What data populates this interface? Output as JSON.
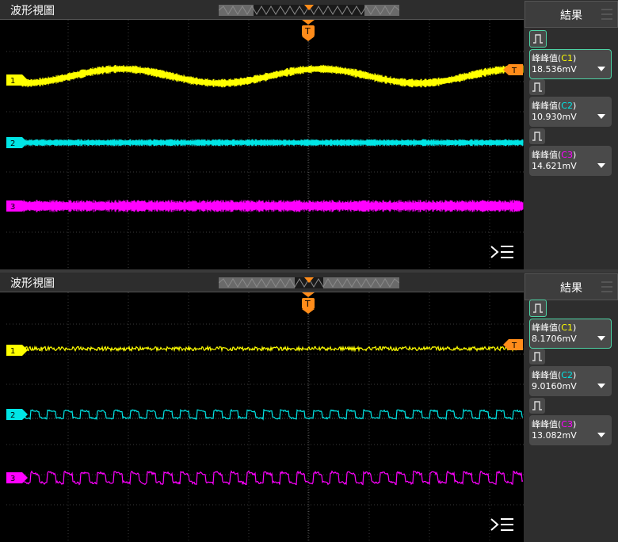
{
  "colors": {
    "ch1": "#ffff00",
    "ch2": "#00e5e5",
    "ch3": "#ff00ff",
    "trigger": "#ff8c1a",
    "accent": "#4dd3a5"
  },
  "panels": [
    {
      "title": "波形視圖",
      "results_title": "結果",
      "channel_markers": [
        "1",
        "2",
        "3"
      ],
      "trigger_label": "T",
      "measurements": [
        {
          "label": "峰峰值",
          "channel": "C1",
          "value": "18.536mV",
          "selected": true,
          "icon": "pulse-icon"
        },
        {
          "label": "峰峰值",
          "channel": "C2",
          "value": "10.930mV",
          "selected": false,
          "icon": "pulse-icon"
        },
        {
          "label": "峰峰值",
          "channel": "C3",
          "value": "14.621mV",
          "selected": false,
          "icon": "pulse-icon"
        }
      ]
    },
    {
      "title": "波形視圖",
      "results_title": "結果",
      "channel_markers": [
        "1",
        "2",
        "3"
      ],
      "trigger_label": "T",
      "measurements": [
        {
          "label": "峰峰值",
          "channel": "C1",
          "value": "8.1706mV",
          "selected": true,
          "icon": "pulse-icon"
        },
        {
          "label": "峰峰值",
          "channel": "C2",
          "value": "9.0160mV",
          "selected": false,
          "icon": "pulse-icon"
        },
        {
          "label": "峰峰值",
          "channel": "C3",
          "value": "13.082mV",
          "selected": false,
          "icon": "pulse-icon"
        }
      ]
    }
  ]
}
